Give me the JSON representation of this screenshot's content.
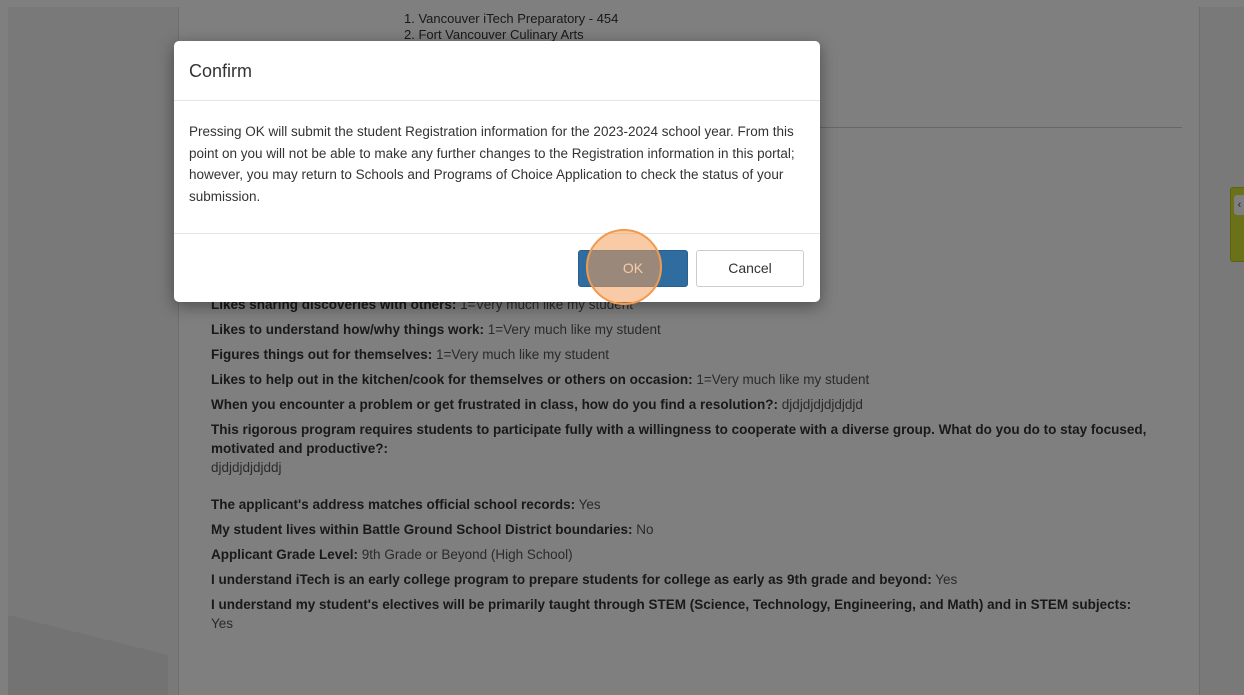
{
  "background": {
    "choices": [
      "1. Vancouver iTech Preparatory - 454",
      "2. Fort Vancouver Culinary Arts"
    ],
    "rows": [
      {
        "q": "Likes sharing discoveries with others:",
        "a": " 1=Very much like my student"
      },
      {
        "q": "Likes to understand how/why things work:",
        "a": " 1=Very much like my student"
      },
      {
        "q": "Figures things out for themselves:",
        "a": " 1=Very much like my student"
      },
      {
        "q": "Likes to help out in the kitchen/cook for themselves or others on occasion:",
        "a": " 1=Very much like my student"
      },
      {
        "q": "When you encounter a problem or get frustrated in class, how do you find a resolution?:",
        "a": " djdjdjdjdjdjdjd"
      },
      {
        "q": "This rigorous program requires students to participate fully with a willingness to cooperate with a diverse group. What do you do to stay focused, motivated and productive?:",
        "a": "djdjdjdjdjddj",
        "block": true
      },
      {
        "q": "The applicant's address matches official school records:",
        "a": " Yes"
      },
      {
        "q": "My student lives within Battle Ground School District boundaries:",
        "a": " No"
      },
      {
        "q": "Applicant Grade Level:",
        "a": " 9th Grade or Beyond (High School)"
      },
      {
        "q": "I understand iTech is an early college program to prepare students for college as early as 9th grade and beyond:",
        "a": " Yes"
      },
      {
        "q": "I understand my student's electives will be primarily taught through STEM (Science, Technology, Engineering, and Math) and in STEM subjects:",
        "a": "Yes",
        "block": true
      }
    ]
  },
  "modal": {
    "title": "Confirm",
    "body": "Pressing OK will submit the student Registration information for the 2023-2024 school year. From this point on you will not be able to make any further changes to the Registration information in this portal; however, you may return to Schools and Programs of Choice Application to check the status of your submission.",
    "ok_label": "OK",
    "cancel_label": "Cancel"
  },
  "side_tab_icon": "chevron-left-icon",
  "colors": {
    "primary": "#2f6da1",
    "highlight": "#f19a4f",
    "side_tab": "#d7e233"
  }
}
